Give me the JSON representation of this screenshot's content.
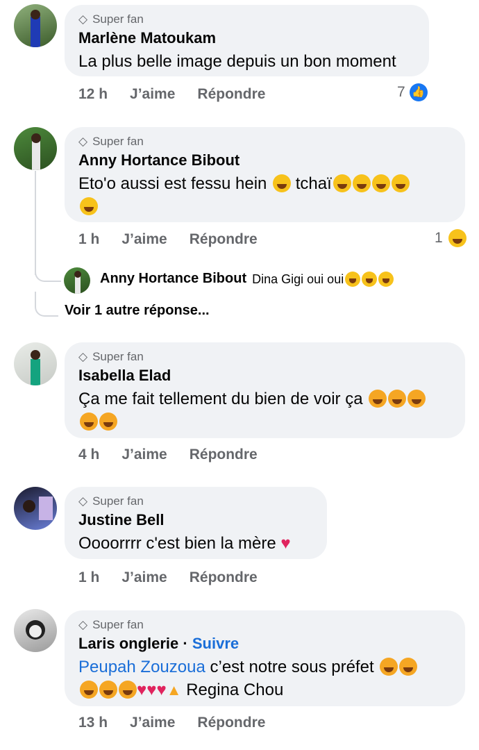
{
  "comments": [
    {
      "badge": "Super fan",
      "name": "Marlène Matoukam",
      "text": "La plus belle image depuis un bon moment",
      "time": "12 h",
      "like": "J’aime",
      "reply": "Répondre",
      "reaction_count": "7",
      "reaction_icon": "like-reaction-icon"
    },
    {
      "badge": "Super fan",
      "name": "Anny Hortance Bibout",
      "text_part1": "Eto'o aussi est fessu hein",
      "text_part2": "tchaï",
      "time": "1 h",
      "like": "J’aime",
      "reply": "Répondre",
      "reaction_count": "1",
      "reaction_icon": "haha-reaction-icon"
    },
    {
      "reply_name": "Anny Hortance Bibout",
      "reply_text": "Dina Gigi oui oui"
    },
    {
      "more_replies": "Voir 1 autre réponse..."
    },
    {
      "badge": "Super fan",
      "name": "Isabella Elad",
      "text": "Ça me fait tellement du bien de voir ça",
      "time": "4 h",
      "like": "J’aime",
      "reply": "Répondre"
    },
    {
      "badge": "Super fan",
      "name": "Justine Bell",
      "text": "Oooorrrr c'est bien la mère",
      "time": "1 h",
      "like": "J’aime",
      "reply": "Répondre"
    },
    {
      "badge": "Super fan",
      "name": "Laris onglerie",
      "follow": "Suivre",
      "mention": "Peupah Zouzoua",
      "text": "c’est notre sous préfet",
      "text_end": "Regina Chou",
      "time": "13 h",
      "like": "J’aime",
      "reply": "Répondre"
    }
  ],
  "colors": {
    "bubble": "#f0f2f5",
    "link": "#1a6ed8",
    "meta": "#65676b"
  }
}
